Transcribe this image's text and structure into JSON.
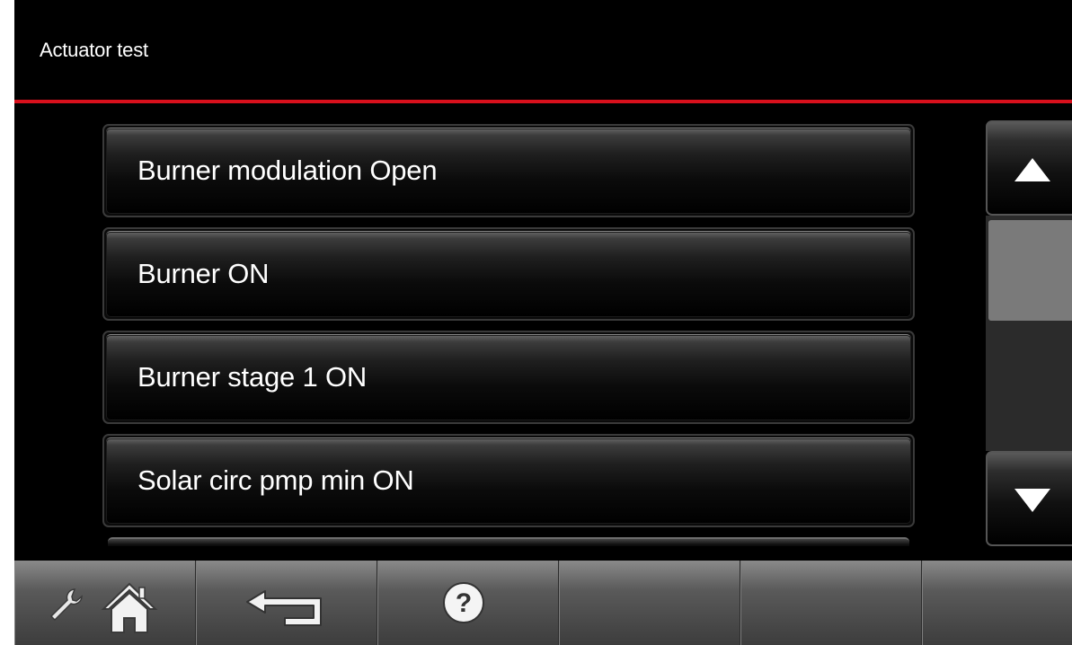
{
  "header": {
    "title": "Actuator test",
    "accent_color": "#d8101c"
  },
  "list": {
    "items": [
      {
        "label": "Burner modulation Open"
      },
      {
        "label": "Burner ON"
      },
      {
        "label": "Burner stage 1 ON"
      },
      {
        "label": "Solar circ pmp min ON"
      }
    ]
  },
  "scrollbar": {
    "up_icon": "triangle-up-icon",
    "down_icon": "triangle-down-icon"
  },
  "footer": {
    "buttons": [
      {
        "icon": "wrench-home-icon",
        "action": "service-home"
      },
      {
        "icon": "back-arrow-icon",
        "action": "back"
      },
      {
        "icon": "help-icon",
        "action": "help"
      },
      {
        "icon": "",
        "action": ""
      },
      {
        "icon": "",
        "action": ""
      },
      {
        "icon": "",
        "action": ""
      }
    ]
  }
}
